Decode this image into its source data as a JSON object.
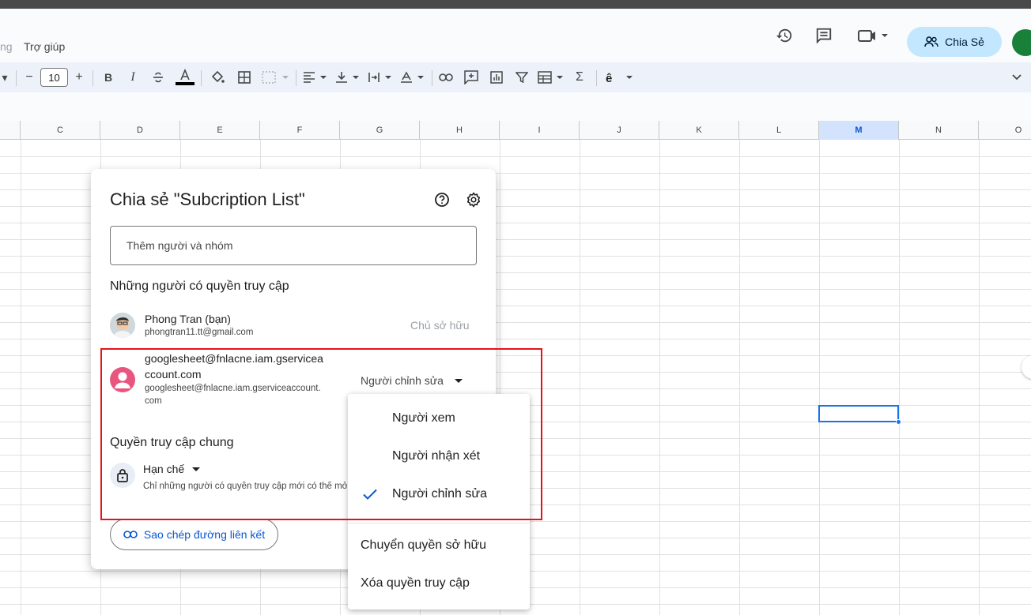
{
  "menubar": {
    "partial": "ng",
    "help": "Trợ giúp"
  },
  "header": {
    "share_label": "Chia Sẻ",
    "icons": [
      "history-icon",
      "comment-icon",
      "video-call-icon"
    ]
  },
  "toolbar": {
    "font_size": "10",
    "minus": "−",
    "plus": "+",
    "bold": "B",
    "italic": "I",
    "sigma": "Σ"
  },
  "grid": {
    "columns": [
      "C",
      "D",
      "E",
      "F",
      "G",
      "H",
      "I",
      "J",
      "K",
      "L",
      "M",
      "N",
      "O"
    ],
    "selected_column": "M"
  },
  "dialog": {
    "title": "Chia sẻ \"Subcription List\"",
    "add_placeholder": "Thêm người và nhóm",
    "people_section": "Những người có quyền truy cập",
    "people": [
      {
        "name": "Phong Tran (bạn)",
        "email": "phongtran11.tt@gmail.com",
        "role": "Chủ sở hữu"
      },
      {
        "name_line1": "googlesheet@fnlacne.iam.gservicea",
        "name_line2": "ccount.com",
        "email_line1": "googlesheet@fnlacne.iam.gserviceaccount.",
        "email_line2": "com",
        "role": "Người chỉnh sửa",
        "avatar_color": "#e8557f"
      }
    ],
    "general_section": "Quyền truy cập chung",
    "general_access": "Hạn chế",
    "general_desc": "Chỉ những người có quyền truy cập mới có thể mở bằng đường liên kết",
    "copy_link": "Sao chép đường liên kết"
  },
  "role_menu": {
    "items": [
      "Người xem",
      "Người nhận xét",
      "Người chỉnh sửa"
    ],
    "selected": "Người chỉnh sửa",
    "extra_items": [
      "Chuyển quyền sở hữu",
      "Xóa quyền truy cập"
    ]
  },
  "colors": {
    "accent": "#0b57d0",
    "highlight": "#e5121a",
    "share_bg": "#c2e7ff"
  }
}
